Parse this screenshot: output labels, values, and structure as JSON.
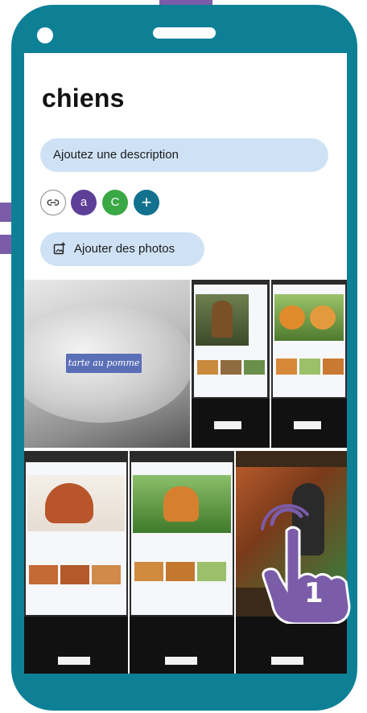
{
  "album": {
    "title": "chiens",
    "description_placeholder": "Ajoutez une description",
    "add_photos_label": "Ajouter des photos"
  },
  "sharing": {
    "link_icon": "link-icon",
    "members": [
      {
        "initial": "a",
        "color": "#5d3f98"
      },
      {
        "initial": "C",
        "color": "#3aa844"
      }
    ],
    "add_member_symbol": "+"
  },
  "photos": [
    {
      "caption": "tarte au pomme"
    }
  ],
  "step_marker": "1",
  "colors": {
    "phone": "#0e8096",
    "accent_pill": "#cfe2f5",
    "decoration": "#7a5ca8"
  }
}
